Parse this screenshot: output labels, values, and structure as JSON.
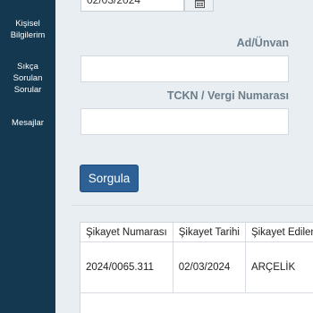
{
  "sidebar": {
    "items": [
      {
        "lines": [
          "Kişisel",
          "Bilgilerim"
        ]
      },
      {
        "lines": [
          "Sıkça",
          "Sorulan",
          "Sorular"
        ]
      },
      {
        "lines": [
          "Mesajlar"
        ]
      }
    ]
  },
  "form": {
    "date_value": "02/03/2024",
    "name_label": "Ad/Ünvan",
    "name_value": "",
    "tckn_label": "TCKN / Vergi Numarası",
    "tckn_value": "",
    "submit_label": "Sorgula"
  },
  "results": {
    "columns": [
      "Şikayet Numarası",
      "Şikayet Tarihi",
      "Şikayet Edilen"
    ],
    "rows": [
      [
        "2024/0065.311",
        "02/03/2024",
        "ARÇELİK"
      ]
    ]
  },
  "colors": {
    "sidebar": "#14384f",
    "primary_button": "#2d6196",
    "label": "#6b7d8a",
    "background": "#e9eef2"
  },
  "icons": {
    "date_picker": "calendar-icon"
  }
}
